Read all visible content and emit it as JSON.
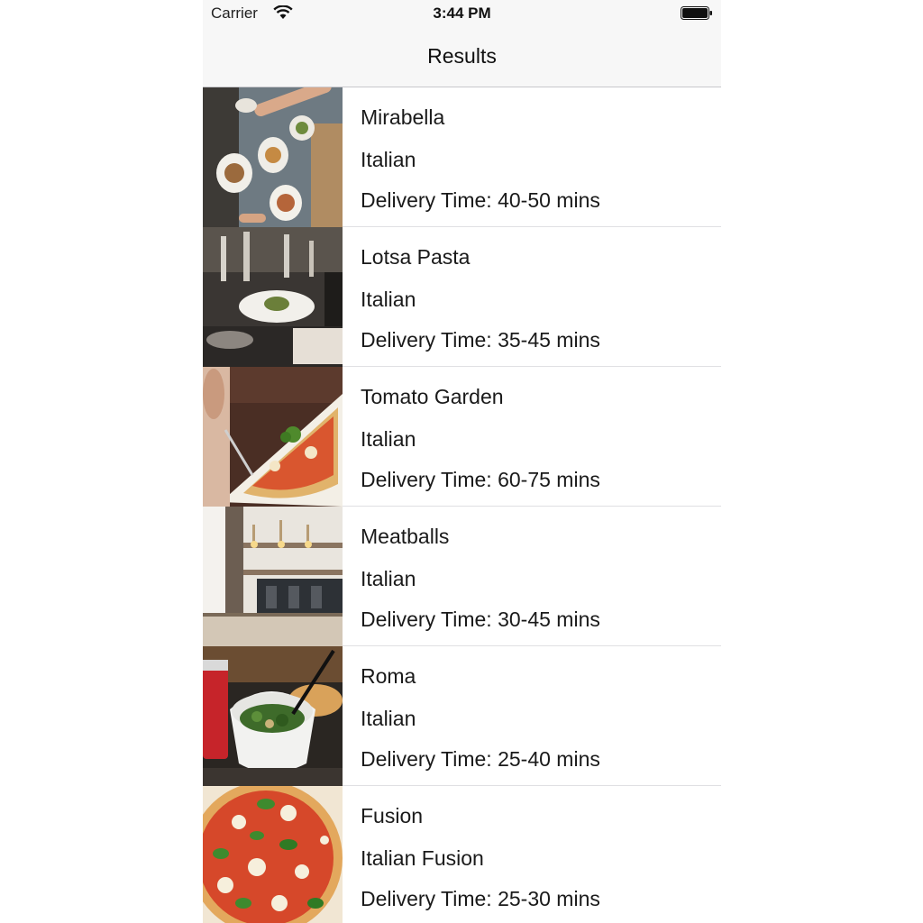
{
  "status_bar": {
    "carrier": "Carrier",
    "time": "3:44 PM",
    "icons": [
      "wifi-icon",
      "battery-icon"
    ]
  },
  "nav": {
    "title": "Results"
  },
  "delivery_prefix": "Delivery Time: ",
  "restaurants": [
    {
      "name": "Mirabella",
      "cuisine": "Italian",
      "delivery_time": "40-50 mins",
      "photo": "table-of-dishes-photo"
    },
    {
      "name": "Lotsa Pasta",
      "cuisine": "Italian",
      "delivery_time": "35-45 mins",
      "photo": "restaurant-table-photo"
    },
    {
      "name": "Tomato Garden",
      "cuisine": "Italian",
      "delivery_time": "60-75 mins",
      "photo": "pizza-slice-photo"
    },
    {
      "name": "Meatballs",
      "cuisine": "Italian",
      "delivery_time": "30-45 mins",
      "photo": "cafe-interior-photo"
    },
    {
      "name": "Roma",
      "cuisine": "Italian",
      "delivery_time": "25-40 mins",
      "photo": "salad-bowl-photo"
    },
    {
      "name": "Fusion",
      "cuisine": "Italian Fusion",
      "delivery_time": "25-30 mins",
      "photo": "pizza-top-down-photo"
    }
  ],
  "colors": {
    "bar_background": "#f7f7f7",
    "separator": "#e0e0e3",
    "text": "#1a1a1a"
  }
}
